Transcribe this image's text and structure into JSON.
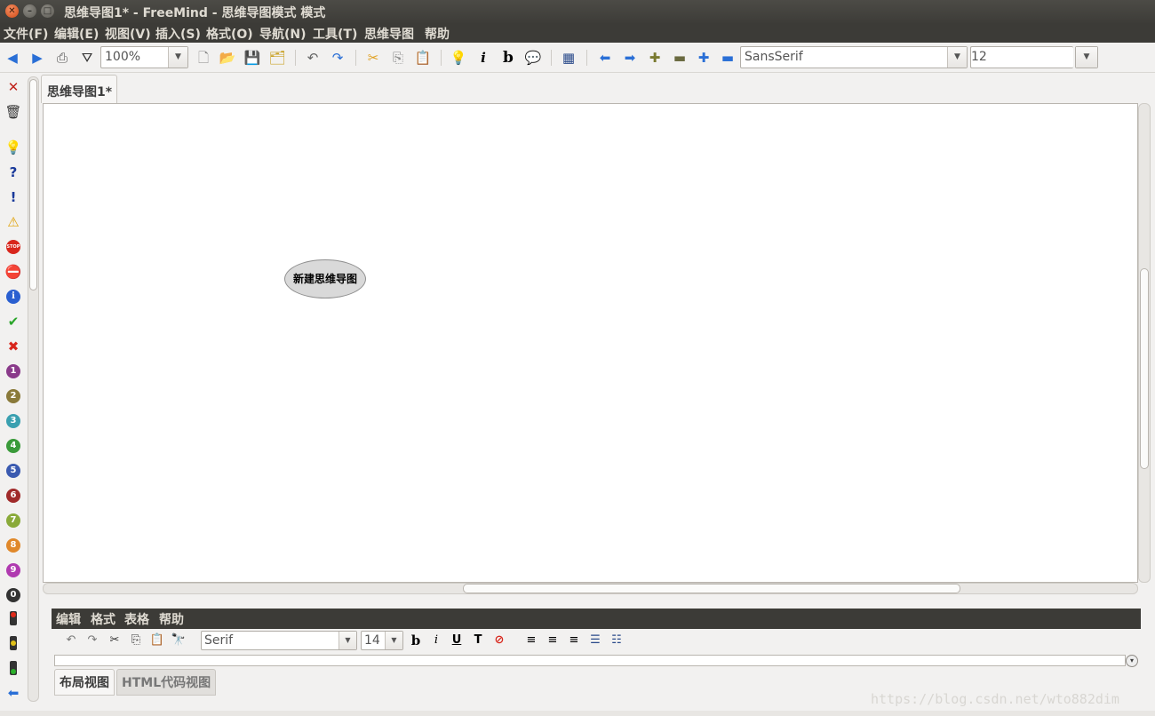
{
  "window": {
    "title": "思维导图1* - FreeMind - 思维导图模式 模式",
    "close_glyph": "✕",
    "min_glyph": "–",
    "max_glyph": "□"
  },
  "menu": [
    "文件(F)",
    "编辑(E)",
    "视图(V)",
    "插入(S)",
    "格式(O)",
    "导航(N)",
    "工具(T)",
    "思维导图",
    "帮助"
  ],
  "toolbar": {
    "zoom": "100%",
    "font": "SansSerif",
    "size": "12",
    "icons": {
      "back": "◀",
      "forward": "▶",
      "print": "⎙",
      "filter": "⛛",
      "new": "🗋",
      "open": "📂",
      "save": "💾",
      "save_as": "🗂",
      "undo": "↶",
      "redo": "↷",
      "cut": "✂",
      "copy": "⎘",
      "paste": "📋",
      "idea": "💡",
      "italic": "i",
      "bold": "b",
      "note": "💬",
      "table": "▦",
      "left": "⬅",
      "right": "➡",
      "plus": "✚",
      "minus": "▬",
      "blue_plus": "✚",
      "blue_minus": "▬",
      "dropdown": "▼"
    }
  },
  "iconbar": {
    "remove_last": "✕",
    "remove_all": "🗑",
    "idea": "💡",
    "question": "?",
    "important": "!",
    "warning": "⚠",
    "stop": "STOP",
    "no_entry": "⛔",
    "info": "i",
    "ok": "✔",
    "not_ok": "✖",
    "priorities": [
      "1",
      "2",
      "3",
      "4",
      "5",
      "6",
      "7",
      "8",
      "9",
      "0"
    ],
    "back": "⬅"
  },
  "tab": {
    "label": "思维导图1*"
  },
  "map": {
    "root_node": "新建思维导图"
  },
  "editor": {
    "menu": [
      "编辑",
      "格式",
      "表格",
      "帮助"
    ],
    "font": "Serif",
    "size": "14",
    "icons": {
      "undo": "↶",
      "redo": "↷",
      "cut": "✂",
      "copy": "⎘",
      "paste": "📋",
      "find": "🔭",
      "bold": "b",
      "italic": "i",
      "underline": "U",
      "color": "T",
      "clear": "⊘",
      "align_left": "≡",
      "align_center": "≡",
      "align_right": "≡",
      "bullet": "☰",
      "numbered": "☷",
      "dropdown": "▼",
      "expand": "▾"
    },
    "tabs": [
      "布局视图",
      "HTML代码视图"
    ]
  },
  "watermark": "https://blog.csdn.net/wto882dim"
}
